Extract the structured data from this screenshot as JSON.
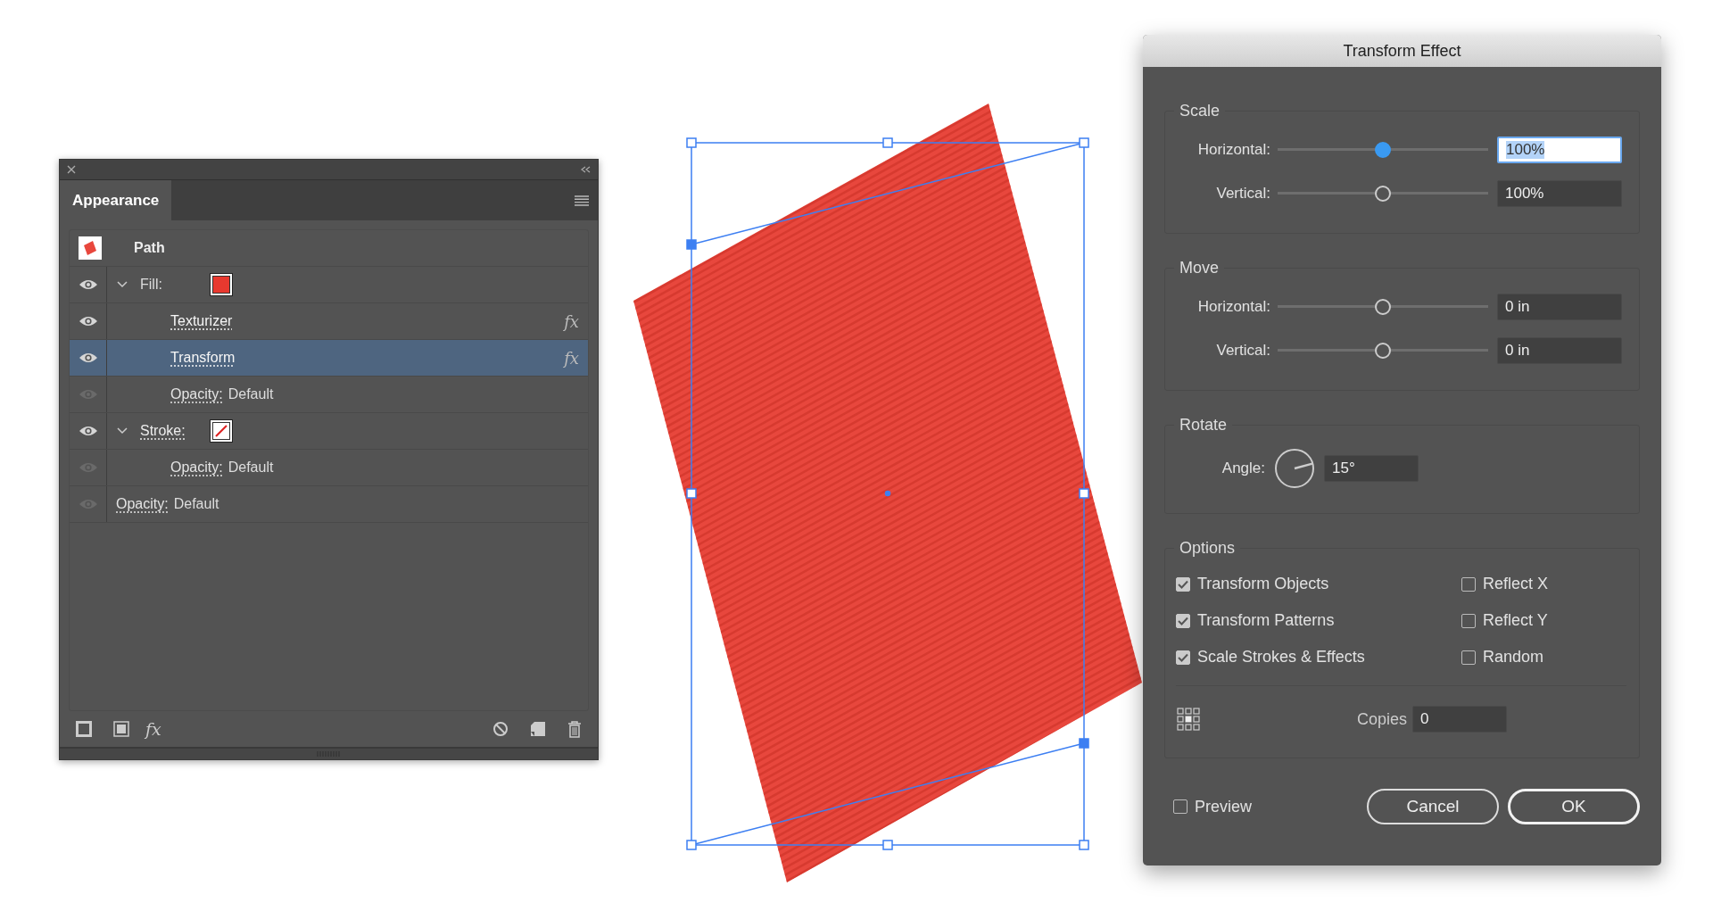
{
  "appearance_panel": {
    "tab": "Appearance",
    "object": {
      "label": "Path"
    },
    "items": [
      {
        "kind": "fill",
        "label": "Fill:",
        "link": false,
        "visible": true,
        "expanded": true,
        "selected": false,
        "children": [
          {
            "kind": "effect",
            "label": "Texturizer",
            "link": true,
            "visible": true,
            "selected": false,
            "badge": "fx"
          },
          {
            "kind": "effect",
            "label": "Transform",
            "link": true,
            "visible": true,
            "selected": true,
            "badge": "fx"
          },
          {
            "kind": "opacity",
            "label": "Opacity:",
            "value": "Default",
            "link": true,
            "visible": false,
            "selected": false
          }
        ]
      },
      {
        "kind": "stroke",
        "label": "Stroke:",
        "link": true,
        "visible": true,
        "expanded": true,
        "selected": false,
        "children": [
          {
            "kind": "opacity",
            "label": "Opacity:",
            "value": "Default",
            "link": true,
            "visible": false,
            "selected": false
          }
        ]
      },
      {
        "kind": "opacity",
        "label": "Opacity:",
        "value": "Default",
        "link": true,
        "visible": false,
        "selected": false
      }
    ],
    "footer": {
      "effect_button": "fx"
    }
  },
  "transform_dialog": {
    "title": "Transform Effect",
    "sections": [
      {
        "title": "Scale",
        "sliders": [
          {
            "label": "Horizontal:",
            "level": 0.5,
            "value": "100%",
            "focused": true
          },
          {
            "label": "Vertical:",
            "level": 0.5,
            "value": "100%",
            "focused": false
          }
        ]
      },
      {
        "title": "Move",
        "sliders": [
          {
            "label": "Horizontal:",
            "level": 0.5,
            "value": "0 in",
            "focused": false
          },
          {
            "label": "Vertical:",
            "level": 0.5,
            "value": "0 in",
            "focused": false
          }
        ]
      }
    ],
    "rotate": {
      "title": "Rotate",
      "label": "Angle:",
      "value": "15°"
    },
    "options": {
      "title": "Options",
      "checkboxes": [
        {
          "label": "Transform Objects",
          "checked": true
        },
        {
          "label": "Reflect X",
          "checked": false
        },
        {
          "label": "Transform Patterns",
          "checked": true
        },
        {
          "label": "Reflect Y",
          "checked": false
        },
        {
          "label": "Scale Strokes & Effects",
          "checked": true
        },
        {
          "label": "Random",
          "checked": false
        }
      ],
      "copies": {
        "label": "Copies",
        "value": "0"
      }
    },
    "preview": {
      "label": "Preview",
      "checked": false
    },
    "buttons": [
      {
        "label": "Cancel",
        "default": false
      },
      {
        "label": "OK",
        "default": true
      }
    ]
  }
}
